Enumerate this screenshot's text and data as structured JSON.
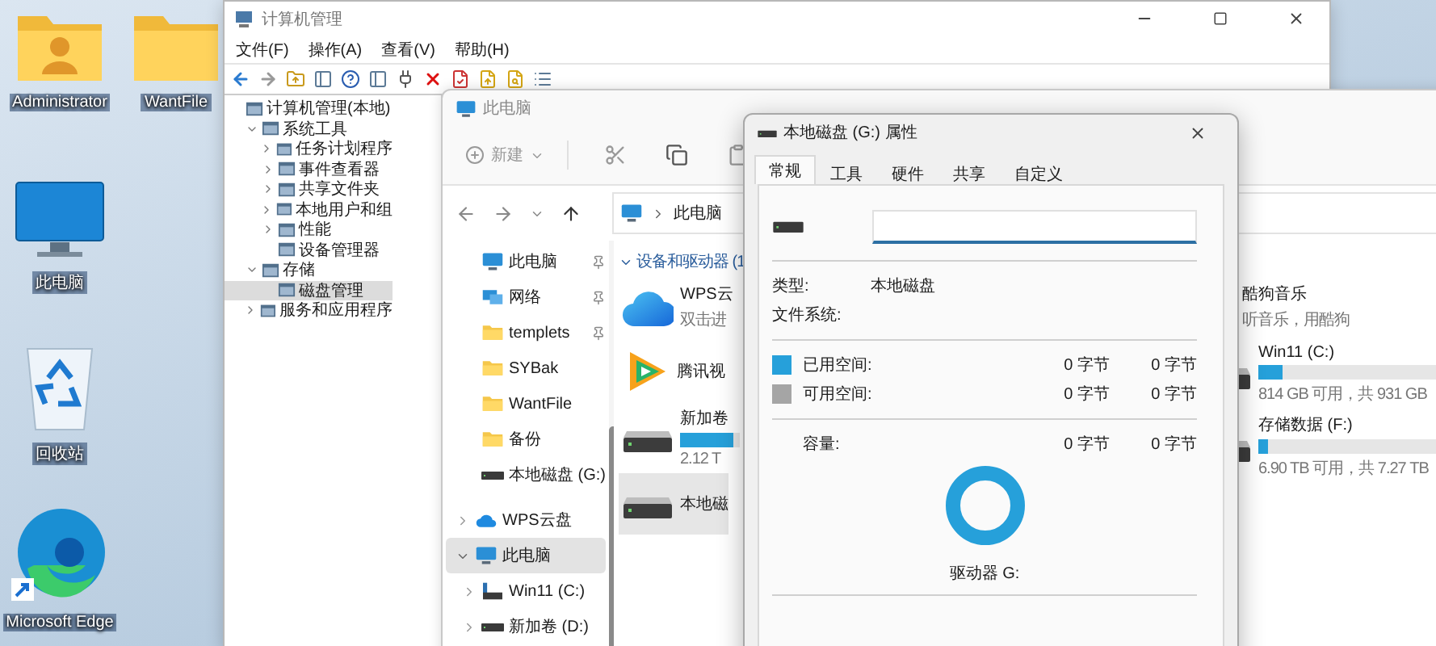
{
  "desktop_icons": [
    {
      "label": "Administrator",
      "kind": "user-folder"
    },
    {
      "label": "WantFile",
      "kind": "folder"
    },
    {
      "label": "此电脑",
      "kind": "monitor"
    },
    {
      "label": "回收站",
      "kind": "recycle-bin"
    },
    {
      "label": "Microsoft Edge",
      "kind": "edge"
    }
  ],
  "management_window": {
    "title": "计算机管理",
    "menu": [
      "文件(F)",
      "操作(A)",
      "查看(V)",
      "帮助(H)"
    ],
    "tree": [
      {
        "label": "计算机管理(本地)",
        "selected": false,
        "children": [
          {
            "label": "系统工具",
            "expanded": true,
            "selected": false,
            "children": [
              {
                "label": "任务计划程序",
                "expanded": false,
                "selected": false
              },
              {
                "label": "事件查看器",
                "expanded": false,
                "selected": false
              },
              {
                "label": "共享文件夹",
                "expanded": false,
                "selected": false
              },
              {
                "label": "本地用户和组",
                "expanded": false,
                "selected": false
              },
              {
                "label": "性能",
                "expanded": false,
                "selected": false
              },
              {
                "label": "设备管理器",
                "selected": false
              }
            ]
          },
          {
            "label": "存储",
            "expanded": true,
            "selected": false,
            "children": [
              {
                "label": "磁盘管理",
                "selected": true
              }
            ]
          },
          {
            "label": "服务和应用程序",
            "expanded": false,
            "selected": false
          }
        ]
      }
    ]
  },
  "explorer": {
    "title": "此电脑",
    "new_label": "新建",
    "address": "此电脑",
    "quick_access": [
      {
        "label": "此电脑",
        "kind": "monitor",
        "pinned": true
      },
      {
        "label": "网络",
        "kind": "network",
        "pinned": true
      },
      {
        "label": "templets",
        "kind": "folder",
        "pinned": true
      },
      {
        "label": "SYBak",
        "kind": "folder",
        "pinned": false
      },
      {
        "label": "WantFile",
        "kind": "folder",
        "pinned": false
      },
      {
        "label": "备份",
        "kind": "folder",
        "pinned": false
      },
      {
        "label": "本地磁盘 (G:)",
        "kind": "drive",
        "pinned": false
      }
    ],
    "nav_tree": [
      {
        "label": "WPS云盘",
        "kind": "cloud",
        "expanded": false,
        "selected": false
      },
      {
        "label": "此电脑",
        "kind": "monitor",
        "expanded": true,
        "selected": true,
        "children": [
          {
            "label": "Win11 (C:)",
            "kind": "system-drive",
            "expanded": false,
            "selected": false
          },
          {
            "label": "新加卷 (D:)",
            "kind": "drive",
            "expanded": false,
            "selected": false
          }
        ]
      }
    ],
    "section_title": "设备和驱动器 (1",
    "items_left": [
      {
        "name": "WPS云",
        "detail": "双击进",
        "kind": "cloud",
        "selected": false
      },
      {
        "name": "腾讯视",
        "kind": "video-app",
        "selected": false
      },
      {
        "name": "新加卷",
        "detail": "2.12 T",
        "kind": "drive",
        "level": 0.9,
        "selected": false
      },
      {
        "name": "本地磁",
        "kind": "drive",
        "selected": true
      }
    ],
    "items_right": [
      {
        "name": "酷狗音乐",
        "detail": "听音乐，用酷狗",
        "kind": "music-app",
        "selected": false
      },
      {
        "name": "Win11 (C:)",
        "detail": "814 GB 可用，共 931 GB",
        "kind": "drive",
        "level": 0.125,
        "selected": false
      },
      {
        "name": "存储数据 (F:)",
        "detail": "6.90 TB 可用，共 7.27 TB",
        "kind": "drive",
        "level": 0.05,
        "selected": false
      }
    ]
  },
  "properties_dialog": {
    "title": "本地磁盘 (G:) 属性",
    "tabs": [
      {
        "label": "常规",
        "selected": true
      },
      {
        "label": "工具",
        "selected": false
      },
      {
        "label": "硬件",
        "selected": false
      },
      {
        "label": "共享",
        "selected": false
      },
      {
        "label": "自定义",
        "selected": false
      }
    ],
    "type_label": "类型:",
    "type_value": "本地磁盘",
    "fs_label": "文件系统:",
    "usage": [
      {
        "label": "已用空间:",
        "color": "#26a0da",
        "bytes": "0 字节",
        "size": "0 字节"
      },
      {
        "label": "可用空间:",
        "color": "#a5a5a5",
        "bytes": "0 字节",
        "size": "0 字节"
      }
    ],
    "capacity": {
      "label": "容量:",
      "bytes": "0 字节",
      "size": "0 字节"
    },
    "drive_label": "驱动器 G:"
  }
}
